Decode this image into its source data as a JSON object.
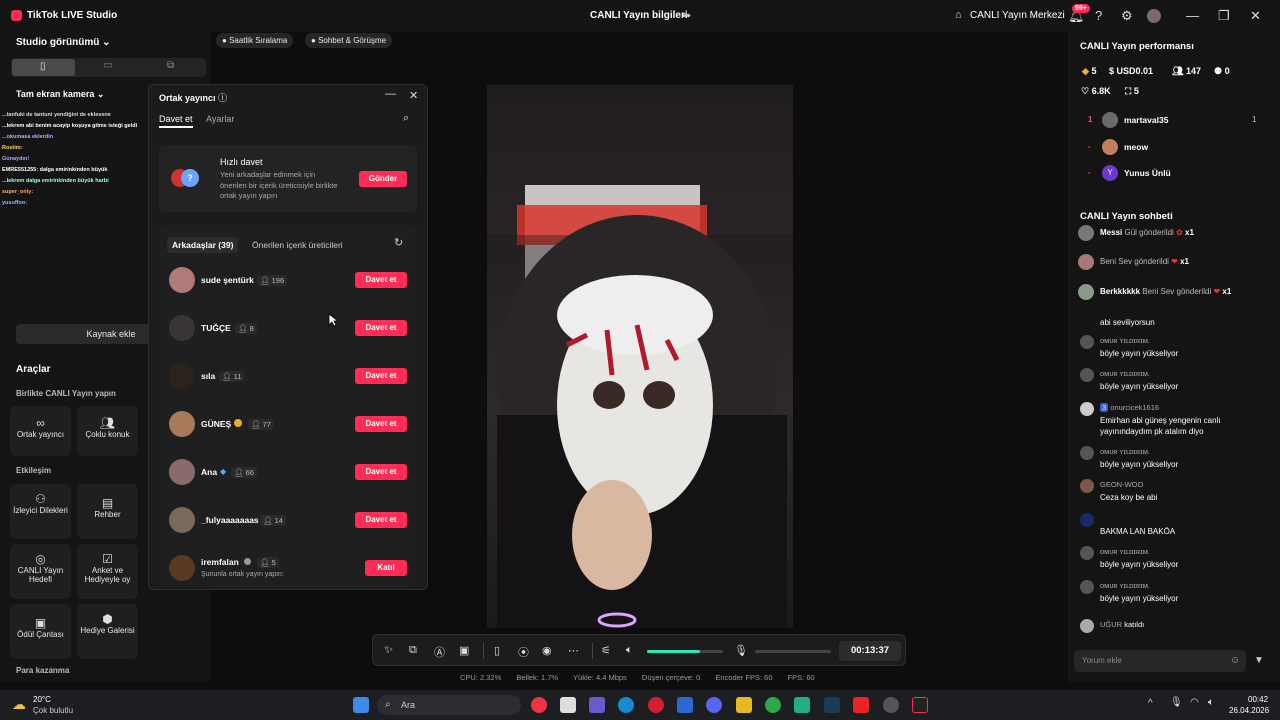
{
  "app": {
    "title": "TikTok LIVE Studio",
    "center_title": "CANLI Yayın bilgileri",
    "live_center": "CANLI Yayın Merkezi",
    "notif_badge": "99+"
  },
  "left": {
    "studio_view": "Studio görünümü",
    "camera": "Tam ekran kamera",
    "add_source": "Kaynak ekle",
    "chat_overlay": [
      "...tanfuki de tantuni yendiğini de eklesene",
      "...lekrem abi benim acayip koşuya gitme isteği geldi",
      "...okumasa eklerdin",
      "Rostim:",
      "Günaydın!",
      "EMRE551255: dalga emirinkinden büyük",
      "...lekrem dalga emirinkinden büyük harbi",
      "super_oniy:",
      "yusuffoo:"
    ],
    "tools_title": "Araçlar",
    "sec_together": "Birlikte CANLI Yayın yapın",
    "sec_interaction": "Etkileşim",
    "sec_money": "Para kazanma",
    "tools": {
      "cohost": "Ortak yayıncı",
      "multi_guest": "Çoklu konuk",
      "viewer_requests": "İzleyici Dilekleri",
      "guide": "Rehber",
      "live_goal": "CANLI Yayın Hedefi",
      "poll": "Anket ve Hediyeyle oy",
      "reward_bag": "Ödül Çantası",
      "gift_gallery": "Hediye Galerisi"
    }
  },
  "chips": {
    "hourly_rank": "Saatlik Sıralama",
    "chat_talk": "Sohbet & Görüşme"
  },
  "modal": {
    "title": "Ortak yayıncı",
    "tab_invite": "Davet et",
    "tab_settings": "Ayarlar",
    "quick_title": "Hızlı davet",
    "quick_desc": "Yeni arkadaşlar edinmek için önerilen bir içerik üreticisiyle birlikte ortak yayın yapın",
    "send": "Gönder",
    "friends_tab": "Arkadaşlar (39)",
    "suggested_tab": "Önerilen içerik üreticileri",
    "invite_label": "Davet et",
    "join_label": "Katıl",
    "friends": [
      {
        "name": "sude şentürk",
        "count": "196",
        "color": "#b07a7a"
      },
      {
        "name": "TUĞÇE",
        "count": "8",
        "color": "#3a3535"
      },
      {
        "name": "sıla",
        "count": "11",
        "color": "#2a241c"
      },
      {
        "name": "GÜNEŞ",
        "count": "77",
        "color": "#a87a5a"
      },
      {
        "name": "Ana",
        "count": "66",
        "color": "#8a6a6a"
      },
      {
        "name": "_fulyaaaaaaas",
        "count": "14",
        "color": "#7a6a5c"
      }
    ],
    "last": {
      "name": "iremfalan",
      "count": "5",
      "sub": "Şununla ortak yayın yapın:"
    }
  },
  "controls": {
    "timer": "00:13:37",
    "volume": 0.7
  },
  "stats": {
    "cpu": "CPU: 2.32%",
    "mem": "Bellek: 1.7%",
    "upload": "Yükle: 4.4 Mbps",
    "dropped": "Düşen çerçeve: 0",
    "encoder": "Encoder FPS: 60",
    "fps": "FPS: 60"
  },
  "right": {
    "perf_title": "CANLI Yayın performansı",
    "diamonds": "5",
    "usd": "USD0.01",
    "viewers": "147",
    "follows": "0",
    "likes": "6.8K",
    "gifts": "5",
    "ranking": [
      {
        "rank": "1",
        "name": "martaval35",
        "score": "1"
      },
      {
        "rank": "-",
        "name": "meow",
        "score": ""
      },
      {
        "rank": "-",
        "name": "Yunus Ünlü",
        "score": ""
      }
    ],
    "chat_title": "CANLI Yayın sohbeti",
    "gift_events": [
      {
        "user": "Messi",
        "text": "Gül gönderildi",
        "x": "x1"
      },
      {
        "user": "",
        "text": "Beni Sev gönderildi",
        "x": "x1"
      },
      {
        "user": "Berkkkkkk",
        "text": "Beni Sev gönderildi",
        "x": "x1"
      }
    ],
    "messages": [
      {
        "name": "",
        "text": "abi seviliyorsun"
      },
      {
        "name": "ᴏᴍᴜʀ ʏɪʟᴅɪʀɪᴍ.",
        "text": "böyle yayın yükseliyor"
      },
      {
        "name": "ᴏᴍᴜʀ ʏɪʟᴅɪʀɪᴍ.",
        "text": "böyle yayın yükseliyor"
      },
      {
        "name": "onurcicek1616",
        "text": "Emirhan abi güneş yengenin canlı yayınındaydım pk atalım diyo"
      },
      {
        "name": "ᴏᴍᴜʀ ʏɪʟᴅɪʀɪᴍ.",
        "text": "böyle yayın yükseliyor"
      },
      {
        "name": "GEON-WOO",
        "text": "Ceza koy be abi"
      },
      {
        "name": "",
        "text": "BAKMA LAN BAKÖA"
      },
      {
        "name": "ᴏᴍᴜʀ ʏɪʟᴅɪʀɪᴍ.",
        "text": "böyle yayın yükseliyor"
      },
      {
        "name": "ᴏᴍᴜʀ ʏɪʟᴅɪʀɪᴍ.",
        "text": "böyle yayın yükseliyor"
      }
    ],
    "join_user": "UĞUR",
    "join_text": "katıldı",
    "level_badge": "3",
    "comment_placeholder": "Yorum ekle"
  },
  "taskbar": {
    "temp": "20°C",
    "weather": "Çok bulutlu",
    "search": "Ara",
    "time": "00:42",
    "date": "26.04.2026"
  }
}
